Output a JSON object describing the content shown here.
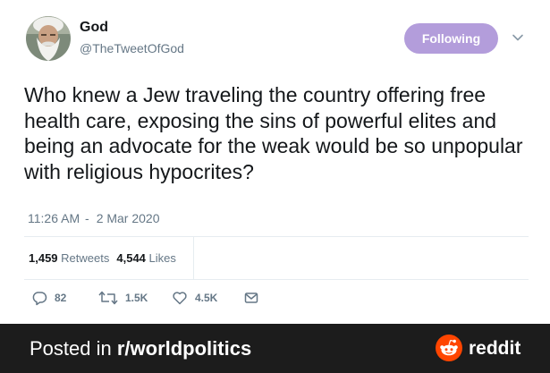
{
  "tweet": {
    "author_name": "God",
    "author_handle": "@TheTweetOfGod",
    "follow_label": "Following",
    "text": "Who knew a Jew traveling the country offering free health care, exposing the sins of powerful elites and being an advocate for the weak would be so unpopular with religious hypocrites?",
    "time": "11:26 AM",
    "time_separator": "-",
    "date": "2 Mar 2020",
    "retweets_count": "1,459",
    "retweets_label": "Retweets",
    "likes_count": "4,544",
    "likes_label": "Likes",
    "reply_count": "82",
    "retweet_count_short": "1.5K",
    "like_count_short": "4.5K",
    "icons": [
      "avatar",
      "chevron-down-icon",
      "reply-icon",
      "retweet-icon",
      "heart-icon",
      "message-icon"
    ]
  },
  "footer": {
    "prefix": "Posted in ",
    "subreddit": "r/worldpolitics",
    "brand": "reddit",
    "brand_color": "#ff4500",
    "background": "#1c1c1c"
  },
  "colors": {
    "follow_button": "#b39ddb",
    "secondary_text": "#657786"
  }
}
